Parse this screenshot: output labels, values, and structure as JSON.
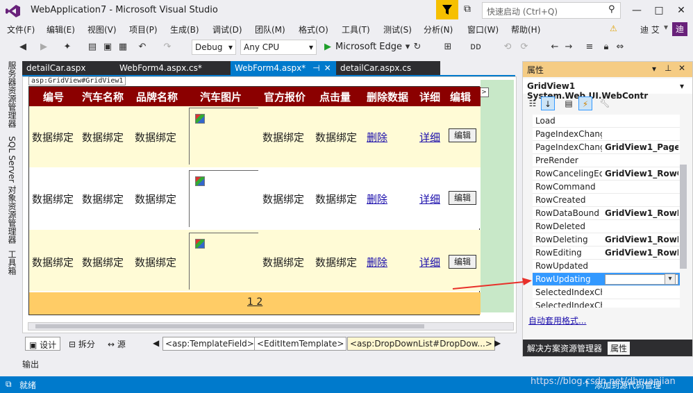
{
  "window": {
    "title": "WebApplication7 - Microsoft Visual Studio",
    "quick_launch_placeholder": "快速启动 (Ctrl+Q)",
    "min": "—",
    "max": "□",
    "close": "✕"
  },
  "menu": [
    "文件(F)",
    "编辑(E)",
    "视图(V)",
    "项目(P)",
    "生成(B)",
    "调试(D)",
    "团队(M)",
    "格式(O)",
    "工具(T)",
    "测试(S)",
    "分析(N)",
    "窗口(W)",
    "帮助(H)"
  ],
  "user": {
    "name": "迪 艾",
    "avatar": "迪"
  },
  "toolbar": {
    "config": "Debug",
    "platform": "Any CPU",
    "browser": "Microsoft Edge"
  },
  "left_tabs": [
    "服务器资源管理器",
    "SQL Server 对象资源管理器",
    "工具箱"
  ],
  "doc_tabs": [
    {
      "label": "detailCar.aspx",
      "active": false
    },
    {
      "label": "WebForm4.aspx.cs*",
      "active": false
    },
    {
      "label": "WebForm4.aspx*",
      "active": true
    },
    {
      "label": "detailCar.aspx.cs",
      "active": false
    }
  ],
  "design": {
    "gridview_tag": "asp:GridView#GridView1",
    "headers": [
      "编号",
      "汽车名称",
      "品牌名称",
      "汽车图片",
      "官方报价",
      "点击量",
      "删除数据",
      "详细",
      "编辑"
    ],
    "cell_text": "数据绑定",
    "delete_link": "删除",
    "detail_link": "详细",
    "edit_button": "编辑",
    "pager": "1 2"
  },
  "viewbar": {
    "design": "设计",
    "split": "拆分",
    "source": "源",
    "crumbs": [
      "<asp:TemplateField>",
      "<EditItemTemplate>",
      "<asp:DropDownList#DropDow...>"
    ]
  },
  "output": "输出",
  "properties": {
    "title": "属性",
    "object": "GridView1  System.Web.UI.WebContr",
    "rows": [
      {
        "name": "Load",
        "value": ""
      },
      {
        "name": "PageIndexChang",
        "value": ""
      },
      {
        "name": "PageIndexChang",
        "value": "GridView1_PageI"
      },
      {
        "name": "PreRender",
        "value": ""
      },
      {
        "name": "RowCancelingEd",
        "value": "GridView1_RowC"
      },
      {
        "name": "RowCommand",
        "value": ""
      },
      {
        "name": "RowCreated",
        "value": ""
      },
      {
        "name": "RowDataBound",
        "value": "GridView1_RowD"
      },
      {
        "name": "RowDeleted",
        "value": ""
      },
      {
        "name": "RowDeleting",
        "value": "GridView1_RowD"
      },
      {
        "name": "RowEditing",
        "value": "GridView1_RowE"
      },
      {
        "name": "RowUpdated",
        "value": ""
      },
      {
        "name": "RowUpdating",
        "value": ""
      },
      {
        "name": "SelectedIndexCh",
        "value": ""
      },
      {
        "name": "SelectedIndexCh",
        "value": ""
      }
    ],
    "autoformat_link": "自动套用格式...",
    "tabs": [
      "解决方案资源管理器",
      "属性"
    ]
  },
  "status": {
    "left": "就绪",
    "right": "添加到源代码管理",
    "watermark": "https://blog.csdn.net/dhruanjian"
  },
  "colors": {
    "accent": "#007acc",
    "header_bg": "#8b0000",
    "pager_bg": "#ffcc66",
    "alt_row": "#fffbd6"
  }
}
